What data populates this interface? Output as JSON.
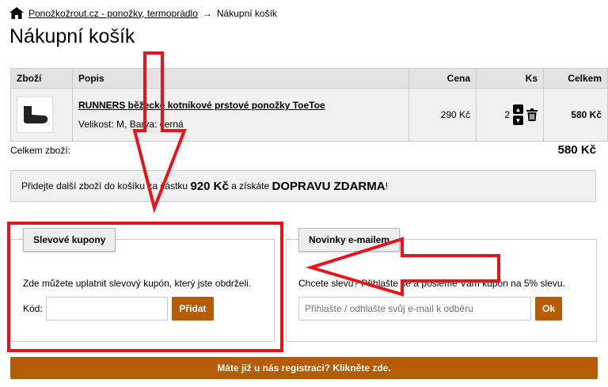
{
  "breadcrumb": {
    "home_link": "Ponožkožrout.cz - ponožky, termoprádlo",
    "separator": "→",
    "current": "Nákupní košík"
  },
  "page_title": "Nákupní košík",
  "cart": {
    "headers": {
      "product": "Zboží",
      "description": "Popis",
      "price": "Cena",
      "qty": "Ks",
      "total": "Celkem"
    },
    "items": [
      {
        "name": "RUNNERS běžecké kotníkové prstové ponožky ToeToe",
        "variant": "Velikost: M, Barva: černá",
        "price": "290 Kč",
        "qty": "2",
        "total": "580 Kč"
      }
    ],
    "summary_label": "Celkem zboží:",
    "summary_value": "580 Kč"
  },
  "shipping": {
    "prefix": "Přidejte další zboží do košíku za částku",
    "amount": "920 Kč",
    "middle": "a získáte",
    "highlight": "DOPRAVU ZDARMA",
    "suffix": "!"
  },
  "coupons": {
    "tab_label": "Slevové kupony",
    "info": "Zde můžete uplatnit slevový kupón, který jste obdrželi.",
    "code_label": "Kód:",
    "code_value": "",
    "add_button": "Přidat"
  },
  "newsletter": {
    "tab_label": "Novinky e-mailem",
    "info": "Chcete slevu? Přihlašte se a pošleme Vám kupón na 5% slevu.",
    "email_placeholder": "Přihlašte / odhlašte svůj e-mail k odběru",
    "ok_button": "Ok"
  },
  "register_bar": "Máte již u nás registraci? Klikněte zde.",
  "colors": {
    "accent": "#b65b06",
    "annotation": "#e8141c"
  }
}
